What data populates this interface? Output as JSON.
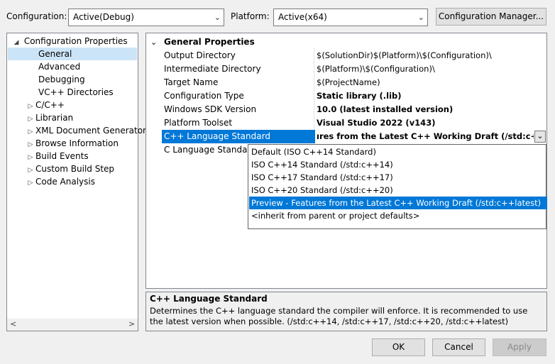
{
  "toolbar": {
    "configuration_label": "Configuration:",
    "configuration_value": "Active(Debug)",
    "platform_label": "Platform:",
    "platform_value": "Active(x64)",
    "config_manager_button": "Configuration Manager..."
  },
  "tree": {
    "root": "Configuration Properties",
    "items": [
      {
        "label": "General",
        "selected": true,
        "expandable": false
      },
      {
        "label": "Advanced",
        "expandable": false
      },
      {
        "label": "Debugging",
        "expandable": false
      },
      {
        "label": "VC++ Directories",
        "expandable": false
      },
      {
        "label": "C/C++",
        "expandable": true
      },
      {
        "label": "Librarian",
        "expandable": true
      },
      {
        "label": "XML Document Generator",
        "expandable": true
      },
      {
        "label": "Browse Information",
        "expandable": true
      },
      {
        "label": "Build Events",
        "expandable": true
      },
      {
        "label": "Custom Build Step",
        "expandable": true
      },
      {
        "label": "Code Analysis",
        "expandable": true
      }
    ]
  },
  "grid": {
    "section_title": "General Properties",
    "rows": [
      {
        "name": "Output Directory",
        "value": "$(SolutionDir)$(Platform)\\$(Configuration)\\",
        "bold": false
      },
      {
        "name": "Intermediate Directory",
        "value": "$(Platform)\\$(Configuration)\\",
        "bold": false
      },
      {
        "name": "Target Name",
        "value": "$(ProjectName)",
        "bold": false
      },
      {
        "name": "Configuration Type",
        "value": "Static library (.lib)",
        "bold": true
      },
      {
        "name": "Windows SDK Version",
        "value": "10.0 (latest installed version)",
        "bold": true
      },
      {
        "name": "Platform Toolset",
        "value": "Visual Studio 2022 (v143)",
        "bold": true
      },
      {
        "name": "C++ Language Standard",
        "value": "ıres from the Latest C++ Working Draft (/std:c++latest)",
        "bold": true,
        "selected": true
      },
      {
        "name": "C Language Standard",
        "value": "",
        "bold": false
      }
    ]
  },
  "dropdown": {
    "options": [
      {
        "label": "Default (ISO C++14 Standard)"
      },
      {
        "label": "ISO C++14 Standard (/std:c++14)"
      },
      {
        "label": "ISO C++17 Standard (/std:c++17)"
      },
      {
        "label": "ISO C++20 Standard (/std:c++20)"
      },
      {
        "label": "Preview - Features from the Latest C++ Working Draft (/std:c++latest)",
        "selected": true
      },
      {
        "label": "<inherit from parent or project defaults>"
      }
    ]
  },
  "description": {
    "title": "C++ Language Standard",
    "text": "Determines the C++ language standard the compiler will enforce. It is recommended to use the latest version when possible.  (/std:c++14, /std:c++17, /std:c++20, /std:c++latest)"
  },
  "buttons": {
    "ok": "OK",
    "cancel": "Cancel",
    "apply": "Apply"
  },
  "icons": {
    "expand_collapsed": "triangle-right-icon",
    "expand_expanded": "triangle-down-icon",
    "chevron": "chevron-down-icon"
  }
}
